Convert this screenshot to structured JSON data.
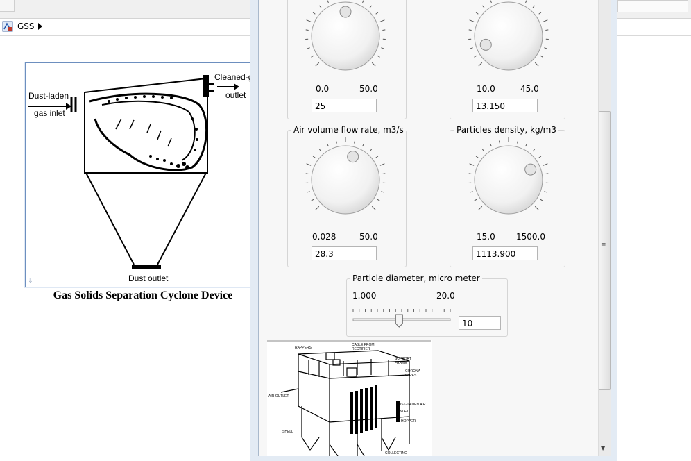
{
  "model_breadcrumb": {
    "name": "GSS"
  },
  "cyclone_block": {
    "caption": "Gas Solids Separation Cyclone Device",
    "labels": {
      "inlet_line1": "Dust-laden",
      "inlet_line2": "gas inlet",
      "outlet_line1": "Cleaned-ga",
      "outlet_line2": "outlet",
      "dust_outlet": "Dust outlet"
    }
  },
  "knobs": [
    {
      "title": "",
      "min": "0.0",
      "max": "50.0",
      "value_text": "25",
      "min_num": 0,
      "max_num": 50,
      "value": 25
    },
    {
      "title": "",
      "min": "10.0",
      "max": "45.0",
      "value_text": "13.150",
      "min_num": 10,
      "max_num": 45,
      "value": 13.15
    },
    {
      "title": "Air volume flow rate, m3/s",
      "min": "0.028",
      "max": "50.0",
      "value_text": "28.3",
      "min_num": 0.028,
      "max_num": 50,
      "value": 28.3
    },
    {
      "title": "Particles density, kg/m3",
      "min": "15.0",
      "max": "1500.0",
      "value_text": "1113.900",
      "min_num": 15,
      "max_num": 1500,
      "value": 1113.9
    }
  ],
  "slider": {
    "title": "Particle diameter, micro meter",
    "min": "1.000",
    "max": "20.0",
    "value_text": "10",
    "min_num": 1,
    "max_num": 20,
    "value": 10
  },
  "precipitator_labels": {
    "rappers": "RAPPERS",
    "cable": "CABLE FROM",
    "rectifier": "RECTIFIER",
    "support1": "SUPPORT",
    "support2": "FRAME",
    "corona1": "CORONA",
    "corona2": "WIRES",
    "air_outlet": "AIR OUTLET",
    "dust_air": "DUST- LADEN AIR",
    "inlet": "INLET",
    "hopper": "HOPPER",
    "shell": "SHELL",
    "collecting": "COLLECTING"
  }
}
